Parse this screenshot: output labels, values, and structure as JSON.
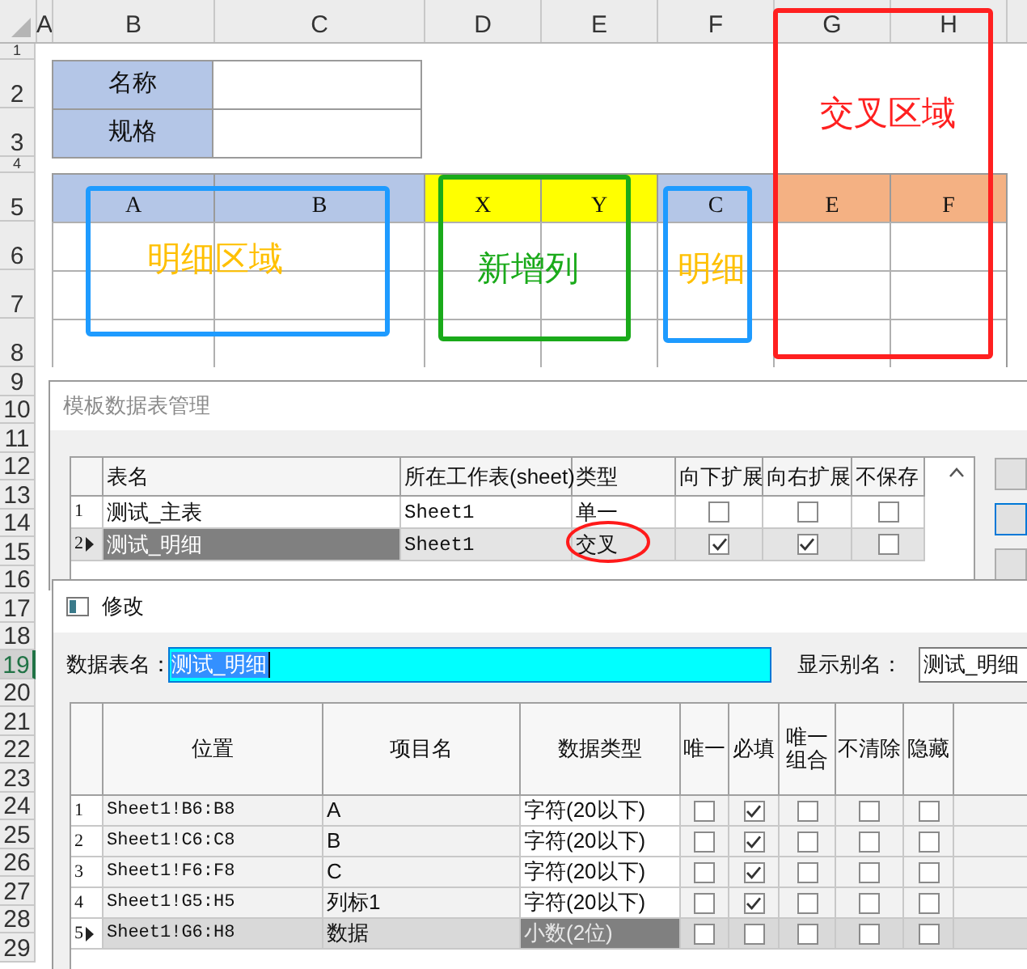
{
  "sheet": {
    "column_headers": [
      "A",
      "B",
      "C",
      "D",
      "E",
      "F",
      "G",
      "H"
    ],
    "row_headers": [
      {
        "label": "1",
        "selected": false
      },
      {
        "label": "2",
        "selected": false
      },
      {
        "label": "3",
        "selected": false
      },
      {
        "label": "4",
        "selected": false
      },
      {
        "label": "5",
        "selected": false
      },
      {
        "label": "6",
        "selected": false
      },
      {
        "label": "7",
        "selected": false
      },
      {
        "label": "8",
        "selected": false
      },
      {
        "label": "9",
        "selected": false
      },
      {
        "label": "10",
        "selected": false
      },
      {
        "label": "11",
        "selected": false
      },
      {
        "label": "12",
        "selected": false
      },
      {
        "label": "13",
        "selected": false
      },
      {
        "label": "14",
        "selected": false
      },
      {
        "label": "15",
        "selected": false
      },
      {
        "label": "16",
        "selected": false
      },
      {
        "label": "17",
        "selected": false
      },
      {
        "label": "18",
        "selected": false
      },
      {
        "label": "19",
        "selected": true
      },
      {
        "label": "20",
        "selected": false
      },
      {
        "label": "21",
        "selected": false
      },
      {
        "label": "22",
        "selected": false
      },
      {
        "label": "23",
        "selected": false
      },
      {
        "label": "24",
        "selected": false
      },
      {
        "label": "25",
        "selected": false
      },
      {
        "label": "26",
        "selected": false
      },
      {
        "label": "27",
        "selected": false
      },
      {
        "label": "28",
        "selected": false
      },
      {
        "label": "29",
        "selected": false
      }
    ],
    "info_labels": [
      "名称",
      "规格"
    ],
    "header_cells": [
      {
        "text": "A",
        "color": "#b4c6e7"
      },
      {
        "text": "B",
        "color": "#b4c6e7"
      },
      {
        "text": "X",
        "color": "#ffff00"
      },
      {
        "text": "Y",
        "color": "#ffff00"
      },
      {
        "text": "C",
        "color": "#b4c6e7"
      },
      {
        "text": "E",
        "color": "#f4b183"
      },
      {
        "text": "F",
        "color": "#f4b183"
      }
    ]
  },
  "annotations": [
    {
      "label": {
        "text": "明细区域",
        "color": "#ffc000"
      },
      "color": "#1e9bff"
    },
    {
      "label": {
        "text": "新增列",
        "color": "#1aaa1a"
      },
      "color": "#1aaa1a"
    },
    {
      "label": {
        "text": "明细",
        "color": "#ffc000"
      },
      "color": "#1e9bff"
    },
    {
      "label": {
        "text": "交叉区域",
        "color": "#ff2020"
      },
      "color": "#ff2020"
    }
  ],
  "table_manager": {
    "title": "模板数据表管理",
    "columns": [
      "表名",
      "所在工作表(sheet)",
      "类型",
      "向下扩展",
      "向右扩展",
      "不保存"
    ],
    "rows": [
      {
        "number": "1",
        "name": "测试_主表",
        "sheet": "Sheet1",
        "type": "单一",
        "expand_down": false,
        "expand_right": false,
        "no_save": false,
        "selected": false,
        "circled": false
      },
      {
        "number": "2",
        "name": "测试_明细",
        "sheet": "Sheet1",
        "type": "交叉",
        "expand_down": true,
        "expand_right": true,
        "no_save": false,
        "selected": true,
        "circled": true
      }
    ]
  },
  "edit_dialog": {
    "title": "修改",
    "name_label": "数据表名：",
    "name_value": "测试_明细",
    "alias_label": "显示别名：",
    "alias_value": "测试_明细",
    "columns": [
      "位置",
      "项目名",
      "数据类型",
      "唯一",
      "必填",
      "唯一组合",
      "不清除",
      "隐藏"
    ],
    "rows": [
      {
        "number": "1",
        "position": "Sheet1!B6:B8",
        "item": "A",
        "data_type": "字符(20以下)",
        "unique": false,
        "required": true,
        "unique_group": false,
        "no_clear": false,
        "hidden": false,
        "selected": false
      },
      {
        "number": "2",
        "position": "Sheet1!C6:C8",
        "item": "B",
        "data_type": "字符(20以下)",
        "unique": false,
        "required": true,
        "unique_group": false,
        "no_clear": false,
        "hidden": false,
        "selected": false
      },
      {
        "number": "3",
        "position": "Sheet1!F6:F8",
        "item": "C",
        "data_type": "字符(20以下)",
        "unique": false,
        "required": true,
        "unique_group": false,
        "no_clear": false,
        "hidden": false,
        "selected": false
      },
      {
        "number": "4",
        "position": "Sheet1!G5:H5",
        "item": "列标1",
        "data_type": "字符(20以下)",
        "unique": false,
        "required": true,
        "unique_group": false,
        "no_clear": false,
        "hidden": false,
        "selected": false
      },
      {
        "number": "5",
        "position": "Sheet1!G6:H8",
        "item": "数据",
        "data_type": "小数(2位)",
        "unique": false,
        "required": false,
        "unique_group": false,
        "no_clear": false,
        "hidden": false,
        "selected": true
      }
    ]
  }
}
